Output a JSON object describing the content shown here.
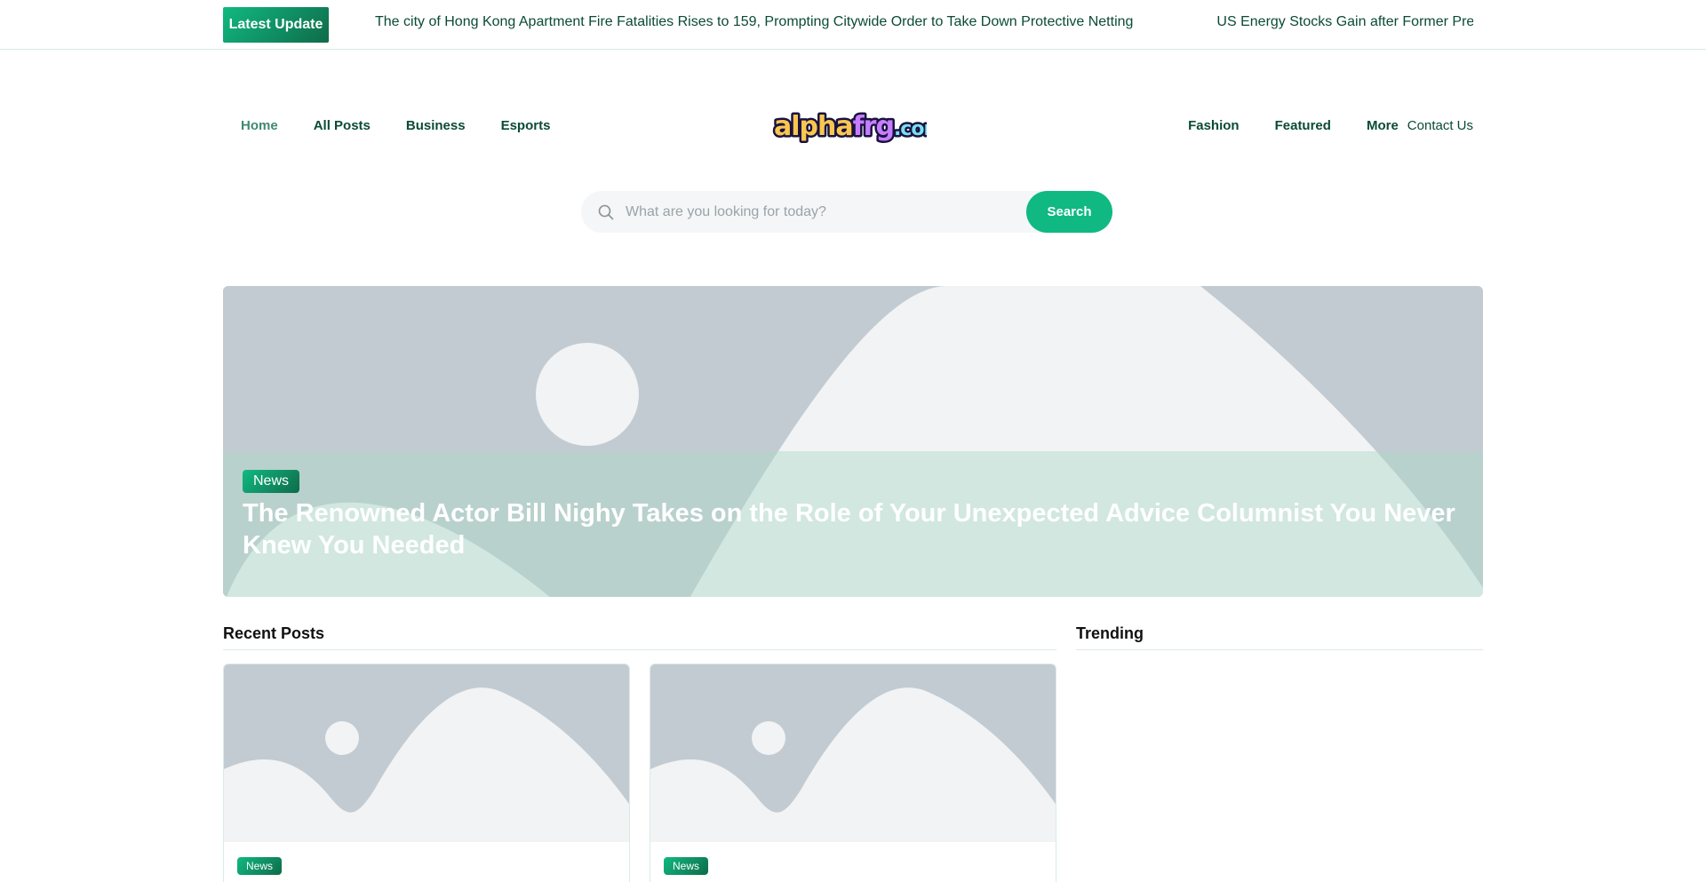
{
  "ticker": {
    "badge": "Latest  Update",
    "items": [
      "The city of Hong Kong Apartment Fire Fatalities Rises to 159, Prompting Citywide Order to Take Down Protective Netting",
      "US Energy Stocks Gain after Former Presi"
    ]
  },
  "nav": {
    "left": [
      "Home",
      "All Posts",
      "Business",
      "Esports"
    ],
    "right": [
      "Fashion",
      "Featured",
      "More",
      "Contact Us"
    ]
  },
  "logo": {
    "text_parts": [
      "alpha",
      "frg",
      ".com"
    ]
  },
  "search": {
    "placeholder": "What are you looking for today?",
    "button": "Search"
  },
  "hero": {
    "category": "News",
    "title": "The Renowned Actor Bill Nighy Takes on the Role of Your Unexpected Advice Columnist You Never Knew You Needed"
  },
  "sections": {
    "recent": "Recent Posts",
    "trending": "Trending"
  },
  "recent_posts": [
    {
      "category": "News"
    },
    {
      "category": "News"
    }
  ],
  "colors": {
    "accent": "#10b981",
    "accent_dark": "#0f6b4a",
    "text": "#0b4b34",
    "placeholder_bg": "#c3cbd2"
  }
}
